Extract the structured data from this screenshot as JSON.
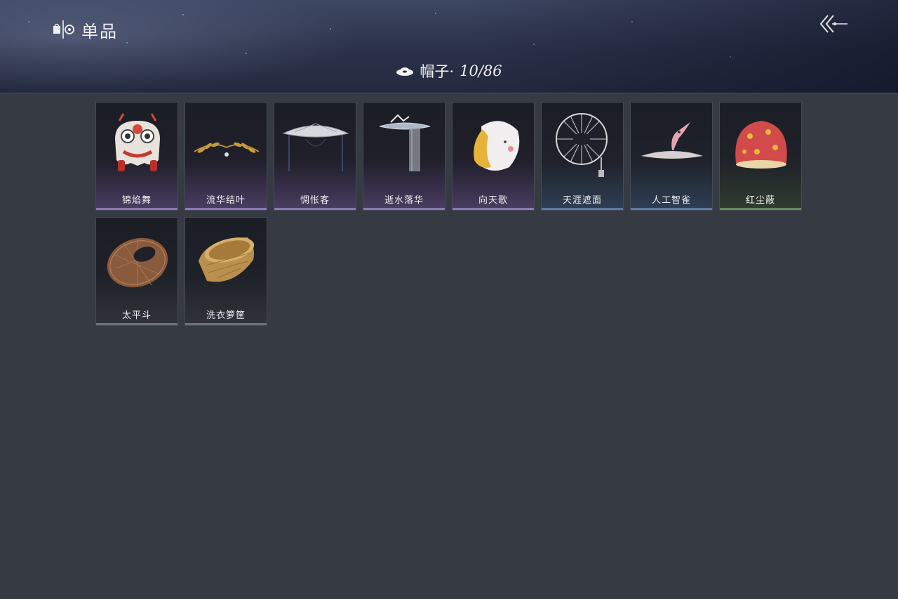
{
  "header": {
    "title": "单品",
    "title_icon": "wardrobe-icon",
    "back_icon": "back-arrow-icon"
  },
  "category": {
    "icon": "hat-icon",
    "label": "帽子·",
    "count": "10/86"
  },
  "items": [
    {
      "name": "锦焰舞",
      "icon": "lion-dance-mask-icon",
      "rarity_color": "#8d79b2"
    },
    {
      "name": "流华结叶",
      "icon": "gold-leaf-circlet-icon",
      "rarity_color": "#8d79b2"
    },
    {
      "name": "惆怅客",
      "icon": "veiled-straw-hat-icon",
      "rarity_color": "#8d79b2"
    },
    {
      "name": "逝水落华",
      "icon": "veil-hat-icon",
      "rarity_color": "#8d79b2"
    },
    {
      "name": "向天歌",
      "icon": "duck-hood-icon",
      "rarity_color": "#8d79b2"
    },
    {
      "name": "天涯遮面",
      "icon": "bamboo-frame-hat-icon",
      "rarity_color": "#5d7aa0"
    },
    {
      "name": "人工智雀",
      "icon": "bird-hat-icon",
      "rarity_color": "#5d7aa0"
    },
    {
      "name": "红尘蔽",
      "icon": "red-dome-hat-icon",
      "rarity_color": "#6a8a5d"
    },
    {
      "name": "太平斗",
      "icon": "woven-bamboo-hat-icon",
      "rarity_color": "#6c707a"
    },
    {
      "name": "洗衣箩筐",
      "icon": "laundry-basket-icon",
      "rarity_color": "#6c707a"
    }
  ]
}
